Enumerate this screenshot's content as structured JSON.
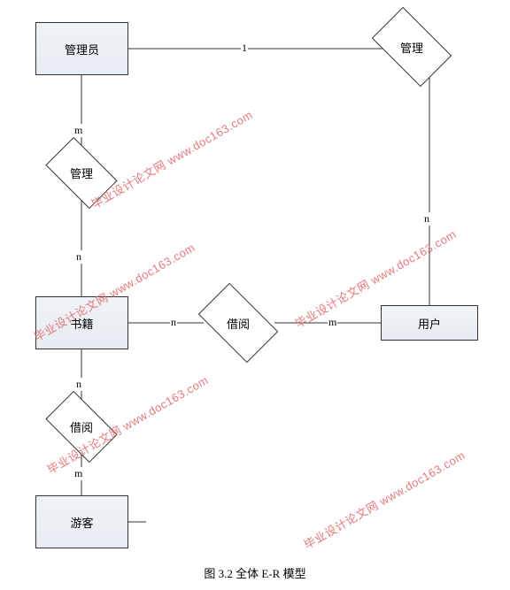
{
  "caption": "图 3.2  全体 E-R 模型",
  "entities": {
    "admin": "管理员",
    "book": "书籍",
    "user": "用户",
    "guest": "游客"
  },
  "relationships": {
    "manage_top": "管理",
    "manage_left": "管理",
    "borrow_mid": "借阅",
    "borrow_left": "借阅"
  },
  "cardinalities": {
    "admin_manage_top": "1",
    "admin_manage_left": "m",
    "manage_left_book": "n",
    "book_borrow_mid": "n",
    "borrow_mid_user": "m",
    "manage_top_user": "n",
    "book_borrow_left": "n",
    "borrow_left_guest": "m"
  },
  "watermark": "毕业设计论文网 www.doc163.com"
}
